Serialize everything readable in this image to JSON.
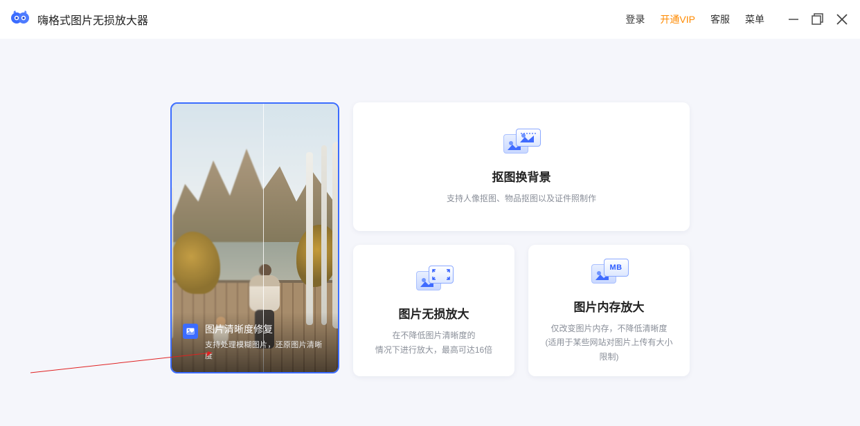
{
  "app": {
    "title": "嗨格式图片无损放大器"
  },
  "header": {
    "login": "登录",
    "vip": "开通VIP",
    "support": "客服",
    "menu": "菜单"
  },
  "features": {
    "clarity": {
      "title": "图片清晰度修复",
      "desc": "支持处理模糊图片，还原图片清晰度"
    },
    "cutout": {
      "title": "抠图换背景",
      "desc": "支持人像抠图、物品抠图以及证件照制作"
    },
    "enlarge": {
      "title": "图片无损放大",
      "desc_l1": "在不降低图片清晰度的",
      "desc_l2": "情况下进行放大，最高可达16倍"
    },
    "memory": {
      "title": "图片内存放大",
      "desc_l1": "仅改变图片内存，不降低清晰度",
      "desc_l2": "(适用于某些网站对图片上传有大小限制)",
      "icon_badge": "MB"
    }
  }
}
